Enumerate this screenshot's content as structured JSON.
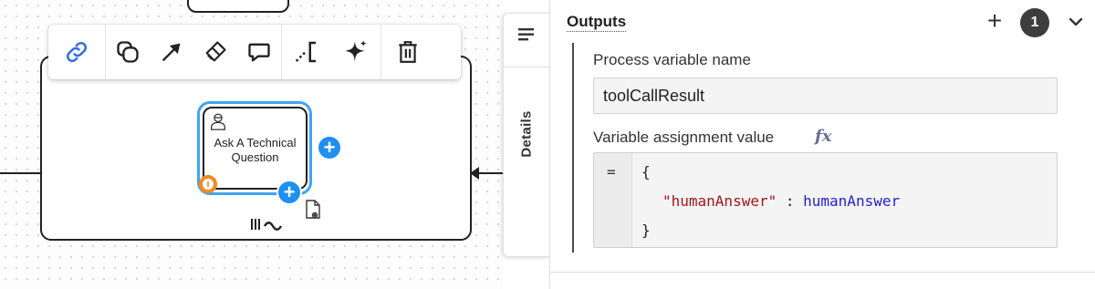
{
  "canvas": {
    "task": {
      "label": "Ask A Technical Question",
      "icon": "user-task-icon"
    },
    "toolbar": {
      "items": [
        {
          "name": "link-icon"
        },
        {
          "name": "change-type-icon"
        },
        {
          "name": "connect-arrow-icon"
        },
        {
          "name": "color-brush-icon"
        },
        {
          "name": "comment-icon"
        },
        {
          "name": "text-annotation-icon"
        },
        {
          "name": "ai-sparkle-icon"
        },
        {
          "name": "delete-icon"
        }
      ]
    }
  },
  "details_tab": {
    "label": "Details"
  },
  "panel": {
    "outputs": {
      "title": "Outputs",
      "add_symbol": "+",
      "count": "1"
    },
    "process_variable": {
      "label": "Process variable name",
      "value": "toolCallResult"
    },
    "assignment": {
      "label": "Variable assignment value",
      "fx_symbol": "fx",
      "equals": "=",
      "line1": "{",
      "key": "\"humanAnswer\"",
      "separator": " : ",
      "var": "humanAnswer",
      "line3": "}"
    }
  },
  "colors": {
    "accent_blue": "#1f8ff0",
    "selection_blue": "#3ea5f2",
    "boundary_orange": "#f5891f",
    "link_blue": "#2f6fe4",
    "badge_dark": "#3d3d3d",
    "code_string": "#a31515",
    "code_var": "#1f1fd0"
  }
}
